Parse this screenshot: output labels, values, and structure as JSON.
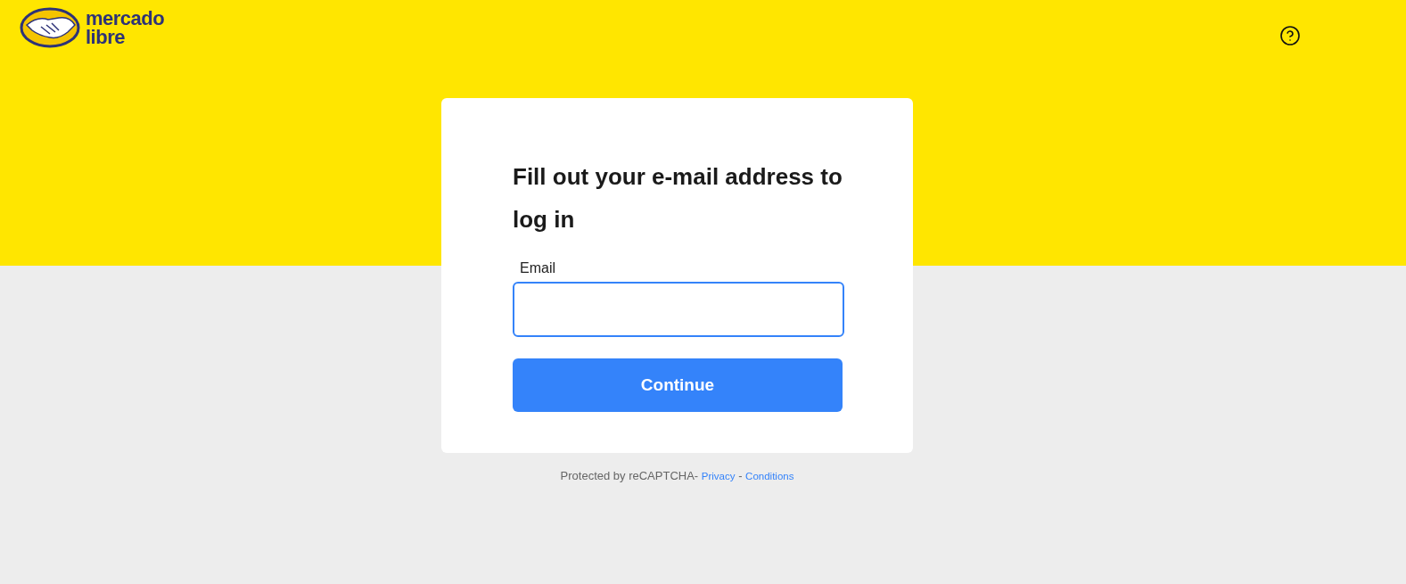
{
  "header": {
    "logo": {
      "line_1": "mercado",
      "line_2": "libre"
    }
  },
  "login_card": {
    "title": "Fill out your e-mail address to log in",
    "email_field": {
      "label": "Email",
      "focused": true
    },
    "continue_button": "Continue"
  },
  "footer": {
    "text": "Protected by reCAPTCHA-",
    "links": [
      "Privacy",
      "Conditions"
    ],
    "separator": "-"
  }
}
